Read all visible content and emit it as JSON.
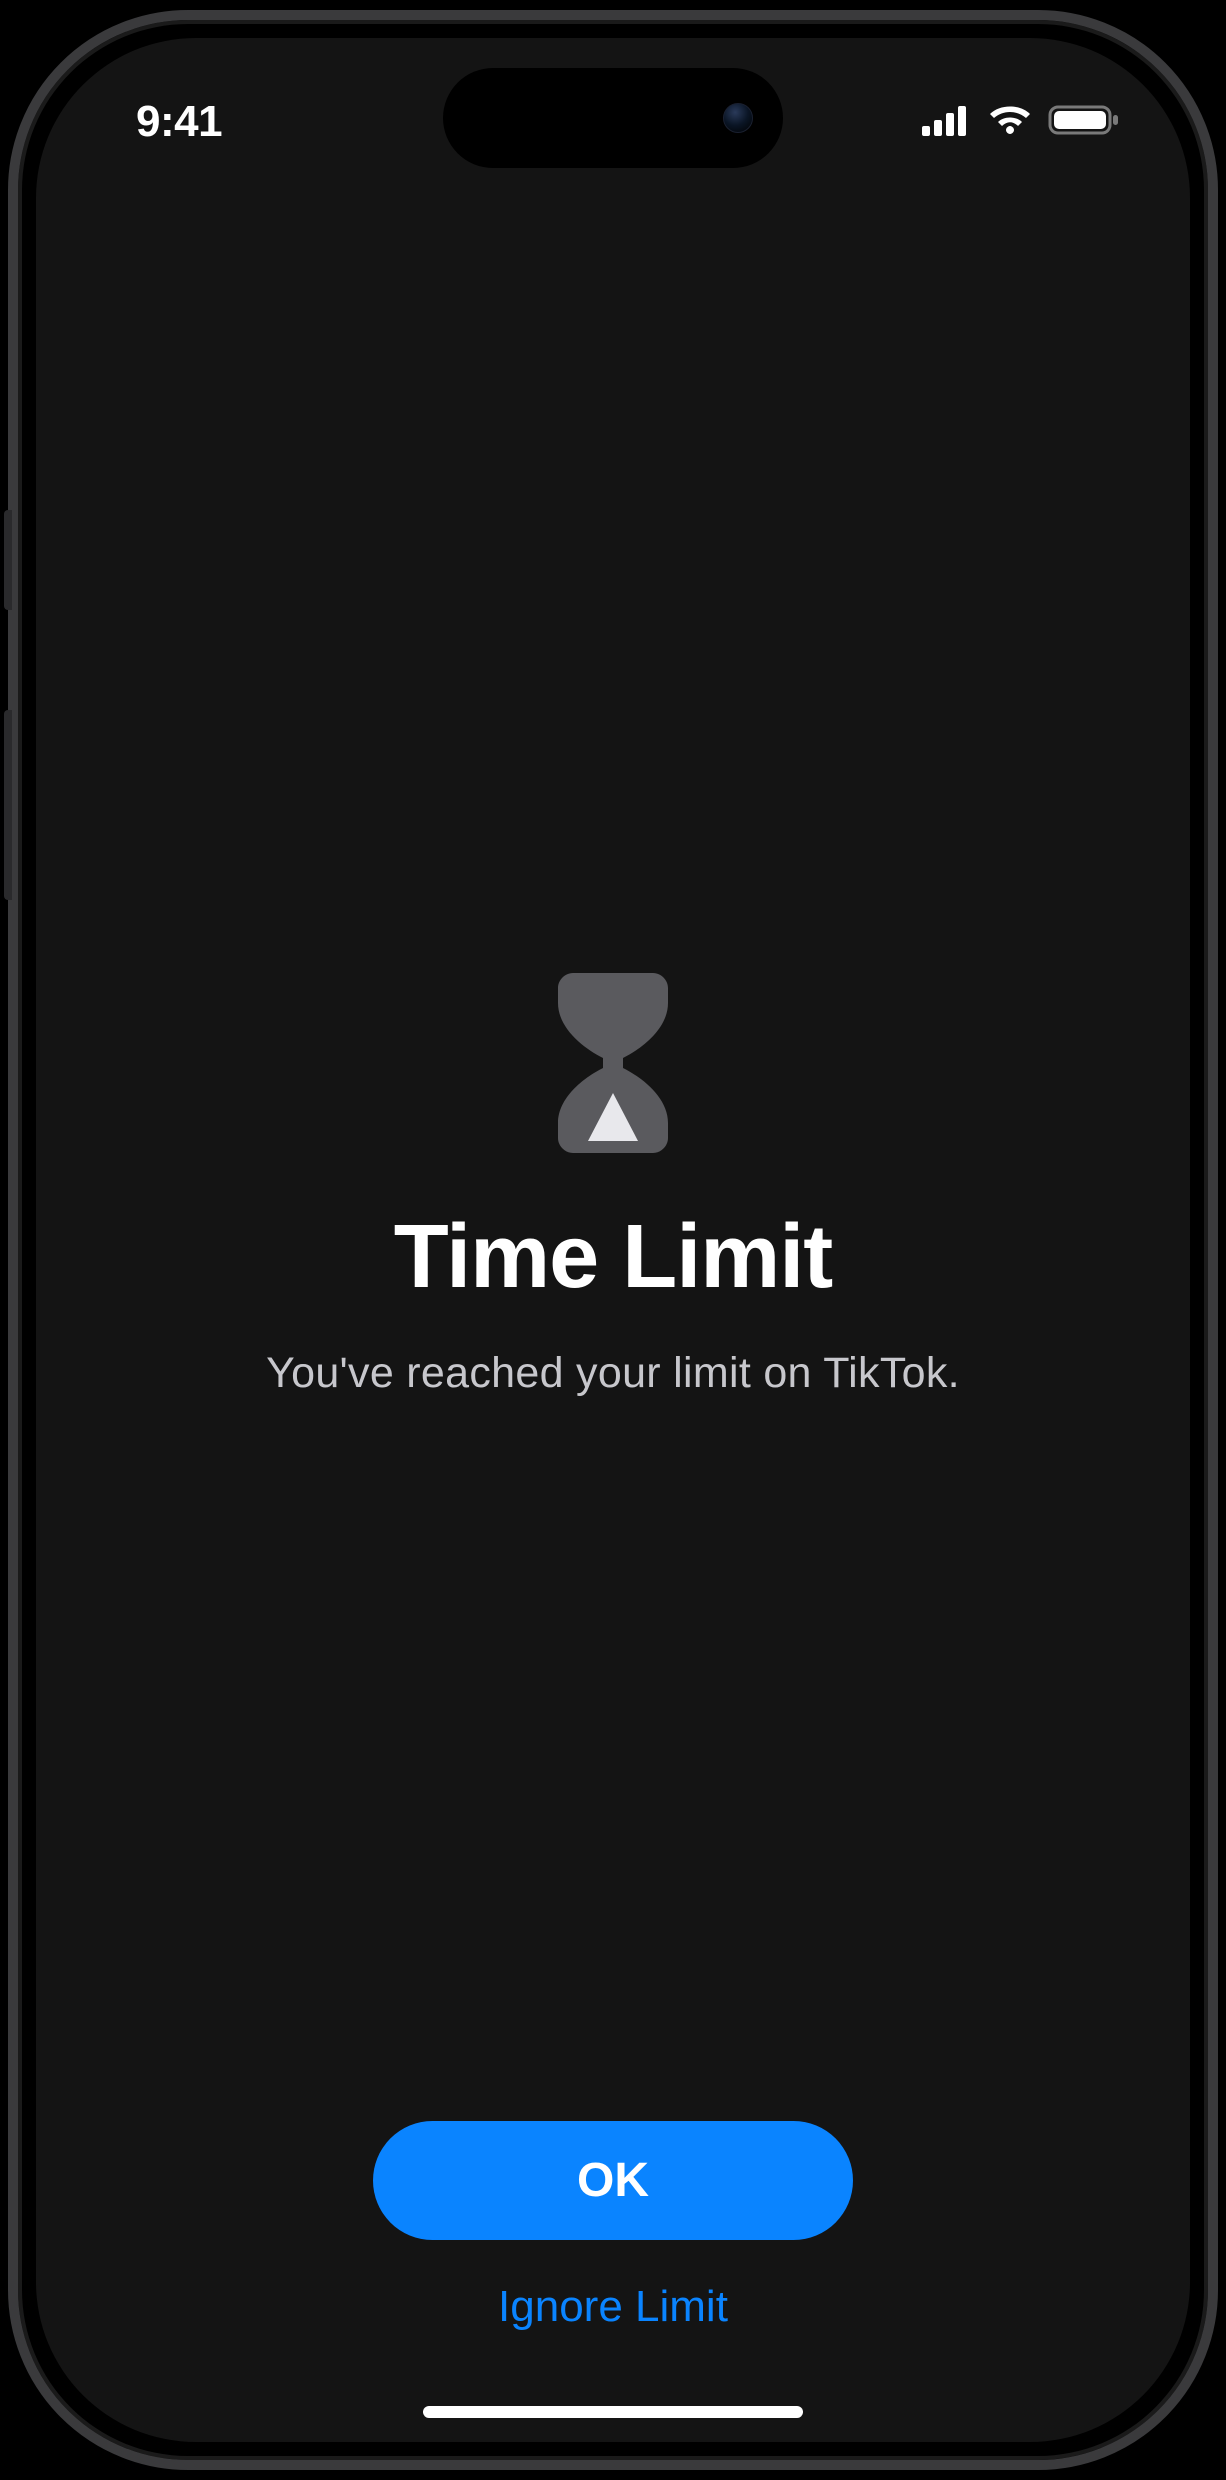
{
  "statusBar": {
    "time": "9:41"
  },
  "screen": {
    "title": "Time Limit",
    "subtitle": "You've reached your limit on TikTok."
  },
  "buttons": {
    "primary": "OK",
    "secondary": "Ignore Limit"
  }
}
